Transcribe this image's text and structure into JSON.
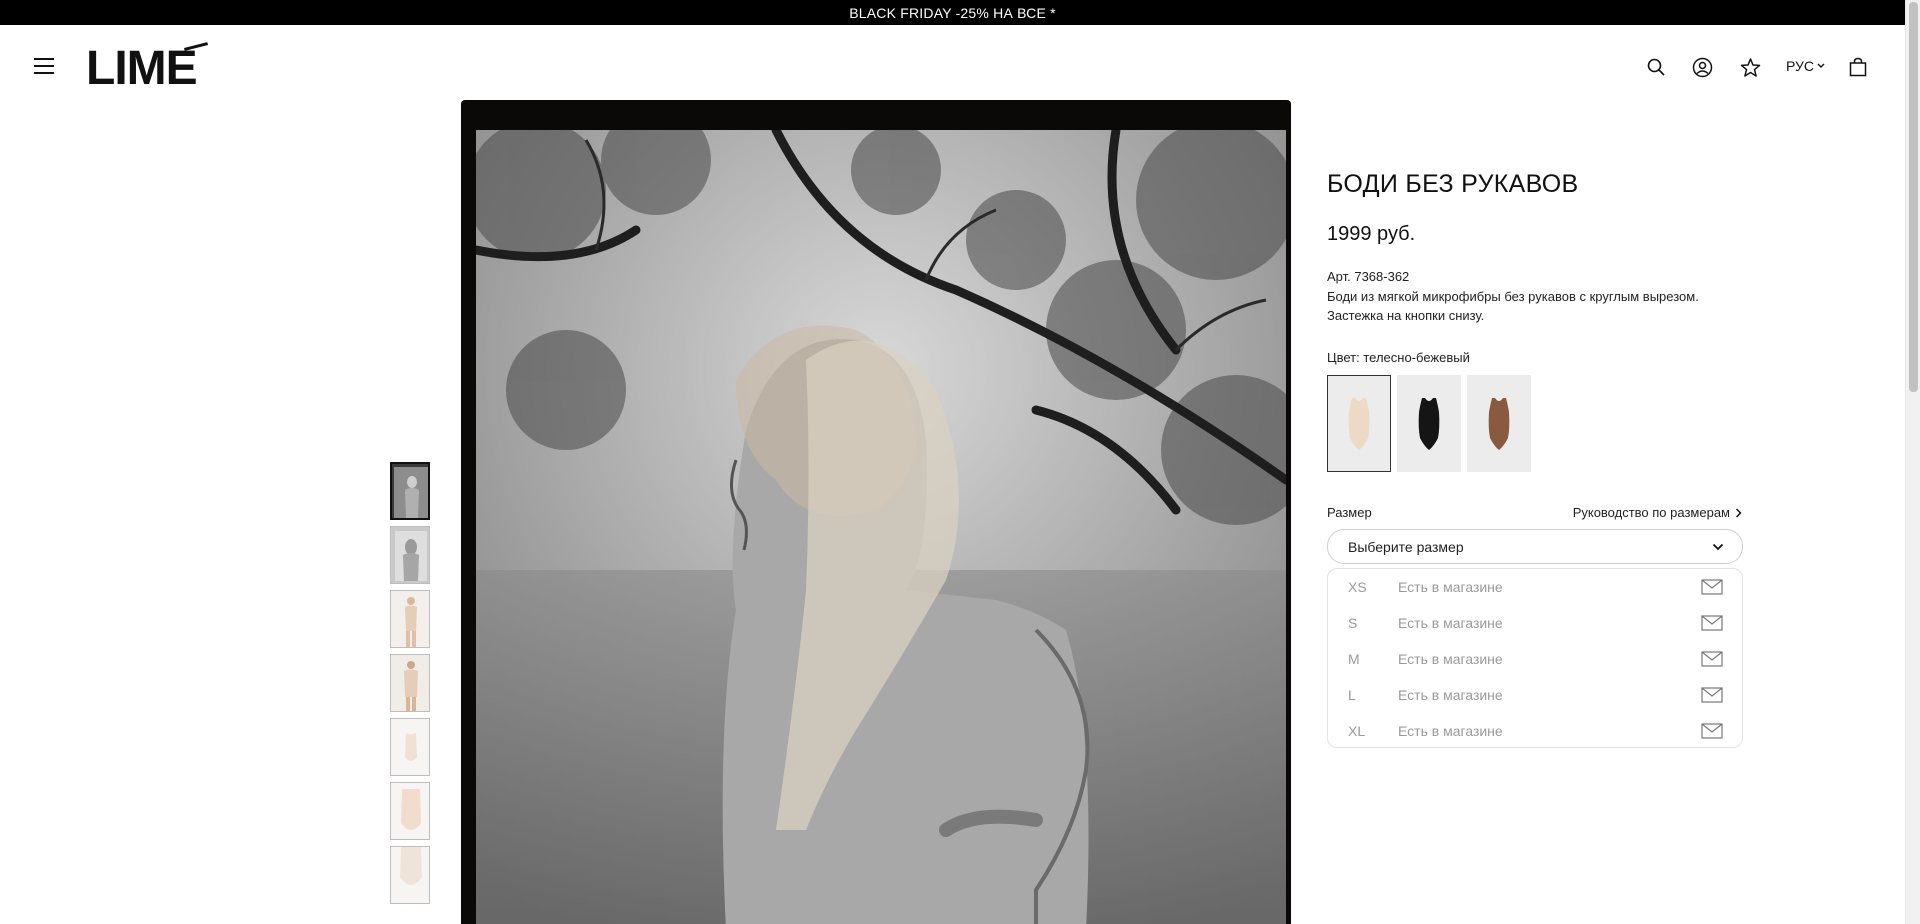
{
  "promo": {
    "text": "BLACK FRIDAY -25% НА ВСЕ *"
  },
  "header": {
    "logo": "LIME",
    "language": "РУС"
  },
  "product": {
    "title": "БОДИ БЕЗ РУКАВОВ",
    "price": "1999 руб.",
    "sku": "Арт. 7368-362",
    "description": "Боди из мягкой микрофибры без рукавов с круглым вырезом. Застежка на кнопки снизу.",
    "color_label": "Цвет: телесно-бежевый",
    "colors": [
      {
        "name": "телесно-бежевый",
        "hex": "#eed8c6",
        "selected": true
      },
      {
        "name": "черный",
        "hex": "#151515",
        "selected": false
      },
      {
        "name": "коричневый",
        "hex": "#8a5a40",
        "selected": false
      }
    ],
    "size_label": "Размер",
    "size_guide": "Руководство по размерам",
    "size_placeholder": "Выберите размер",
    "sizes": [
      {
        "name": "XS",
        "status": "Есть в магазине"
      },
      {
        "name": "S",
        "status": "Есть в магазине"
      },
      {
        "name": "M",
        "status": "Есть в магазине"
      },
      {
        "name": "L",
        "status": "Есть в магазине"
      },
      {
        "name": "XL",
        "status": "Есть в магазине"
      }
    ]
  },
  "colors": {
    "promo_bg": "#000000",
    "text": "#111111",
    "muted": "#9a9a9a",
    "swatch_bg": "#ececec"
  }
}
